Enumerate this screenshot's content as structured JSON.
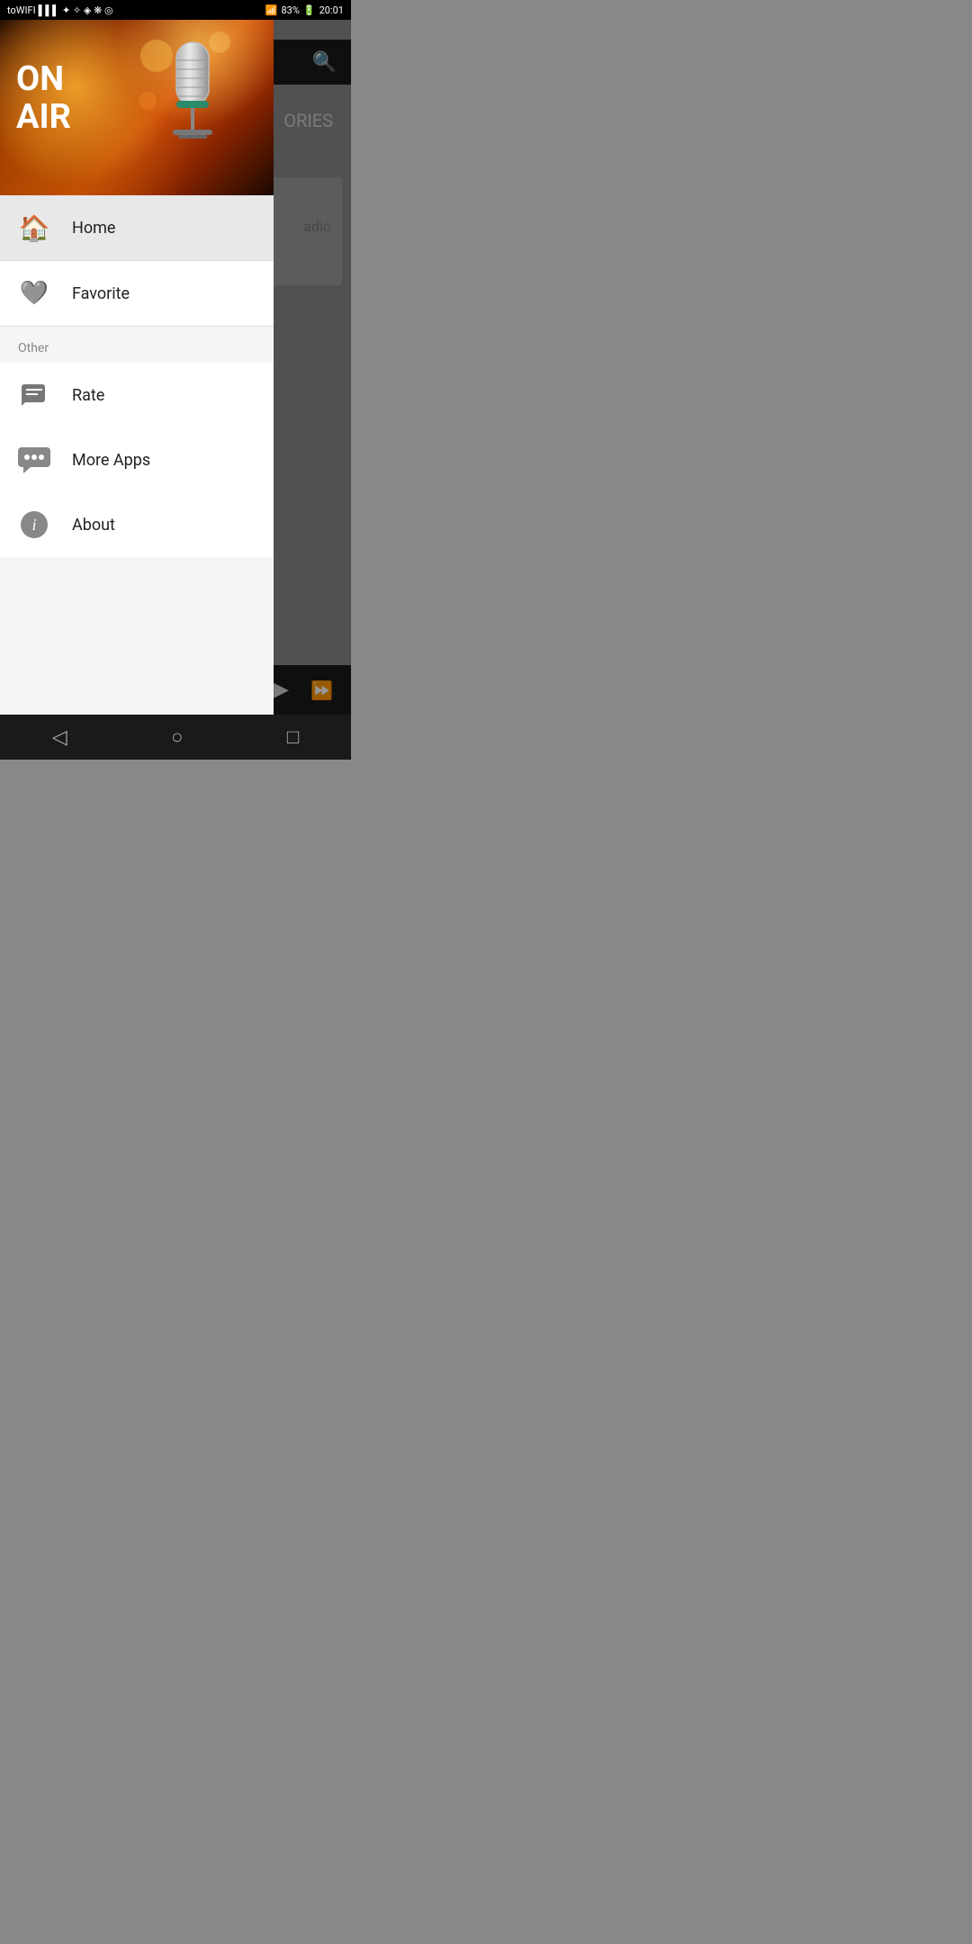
{
  "statusBar": {
    "left": "toWIFI",
    "signal": "▌▌▌",
    "time": "20:01",
    "battery": "83%"
  },
  "header": {
    "onAir": {
      "on": "ON",
      "air": "AIR"
    }
  },
  "background": {
    "partialText": "ORIES",
    "radioText": "adio",
    "searchIcon": "🔍"
  },
  "player": {
    "playIcon": "▶",
    "ffIcon": "⏩"
  },
  "navBar": {
    "back": "◁",
    "home": "○",
    "recent": "□"
  },
  "drawer": {
    "items": [
      {
        "id": "home",
        "label": "Home",
        "icon": "home"
      },
      {
        "id": "favorite",
        "label": "Favorite",
        "icon": "heart"
      }
    ],
    "sectionLabel": "Other",
    "otherItems": [
      {
        "id": "rate",
        "label": "Rate",
        "icon": "rate"
      },
      {
        "id": "more-apps",
        "label": "More Apps",
        "icon": "more-apps"
      },
      {
        "id": "about",
        "label": "About",
        "icon": "info"
      }
    ]
  }
}
